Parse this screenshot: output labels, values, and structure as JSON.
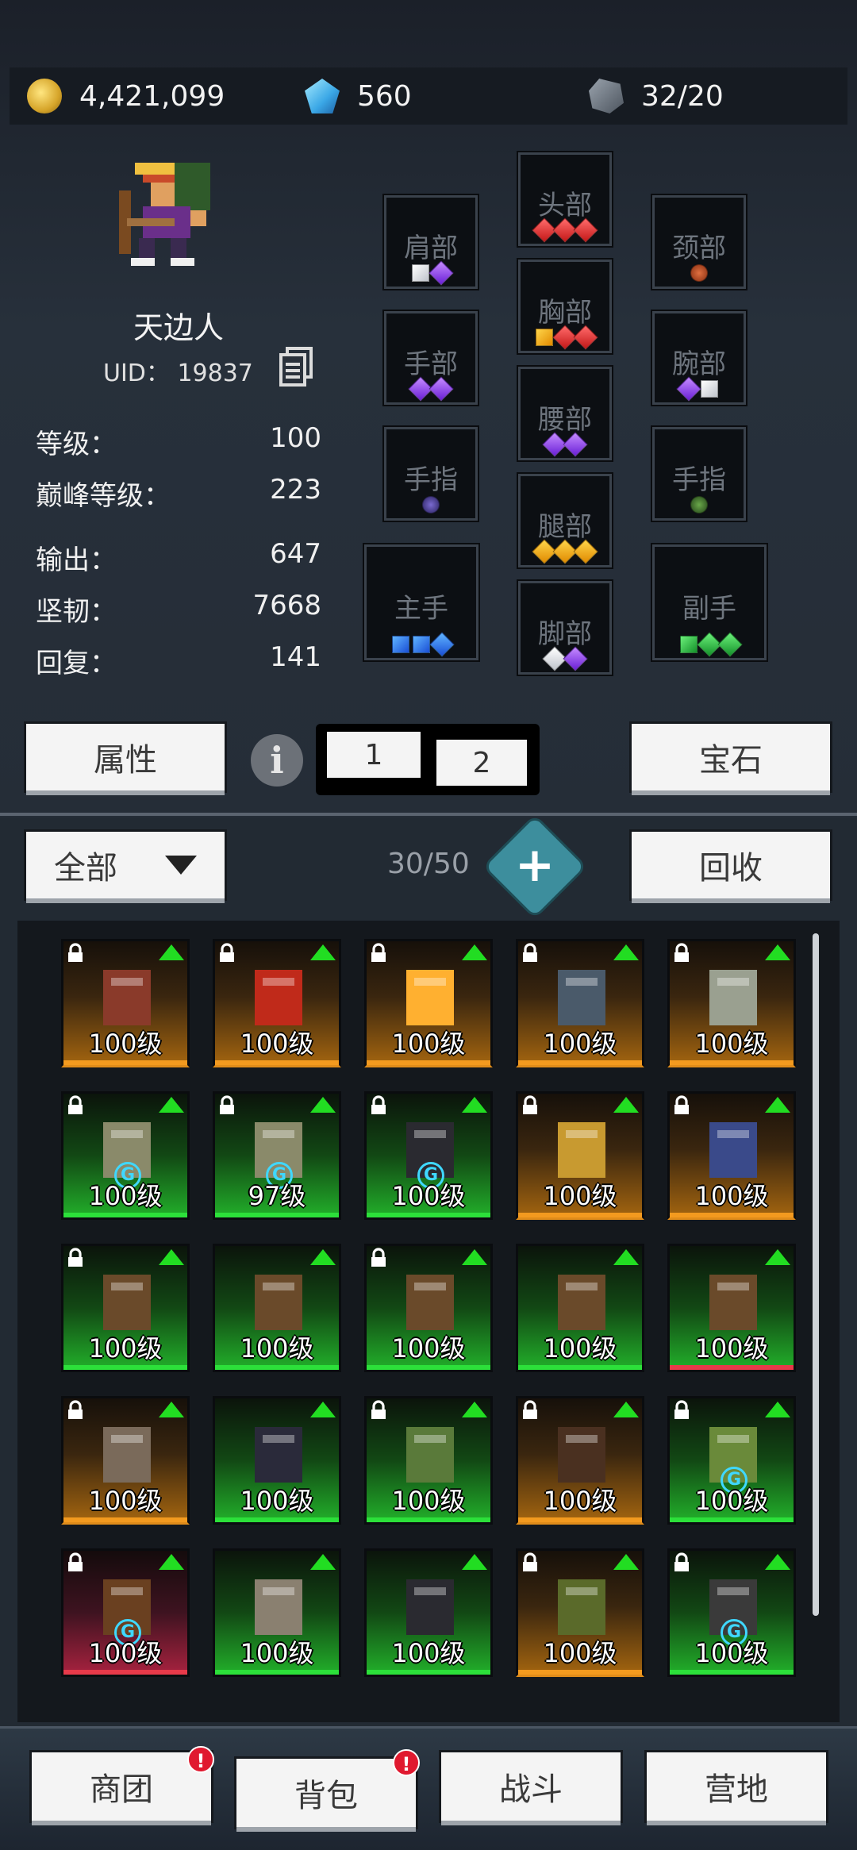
{
  "currency": {
    "gold": "4,421,099",
    "gems": "560",
    "ore": "32/20"
  },
  "character": {
    "name": "天边人",
    "uid": "UID：  19837",
    "stats": [
      {
        "label": "等级：",
        "value": "100"
      },
      {
        "label": "巅峰等级：",
        "value": "223"
      },
      {
        "label": "输出：",
        "value": "647"
      },
      {
        "label": "坚韧：",
        "value": "7668"
      },
      {
        "label": "回复：",
        "value": "141"
      }
    ]
  },
  "slots": {
    "head": "头部",
    "shoulder": "肩部",
    "neck": "颈部",
    "chest": "胸部",
    "hand": "手部",
    "wrist": "腕部",
    "waist": "腰部",
    "finger_l": "手指",
    "finger_r": "手指",
    "legs": "腿部",
    "main_hand": "主手",
    "off_hand": "副手",
    "feet": "脚部"
  },
  "controls": {
    "attributes_btn": "属性",
    "tab1": "1",
    "tab2": "2",
    "gems_btn": "宝石",
    "filter": "全部",
    "bag_count": "30/50",
    "recycle_btn": "回收"
  },
  "inventory": [
    "100级",
    "100级",
    "100级",
    "100级",
    "100级",
    "100级",
    "97级",
    "100级",
    "100级",
    "100级",
    "100级",
    "100级",
    "100级",
    "100级",
    "100级",
    "100级",
    "100级",
    "100级",
    "100级",
    "100级",
    "100级",
    "100级",
    "100级",
    "100级",
    "100级"
  ],
  "nav": {
    "guild": "商团",
    "bag": "背包",
    "battle": "战斗",
    "camp": "营地",
    "alert": "!"
  }
}
